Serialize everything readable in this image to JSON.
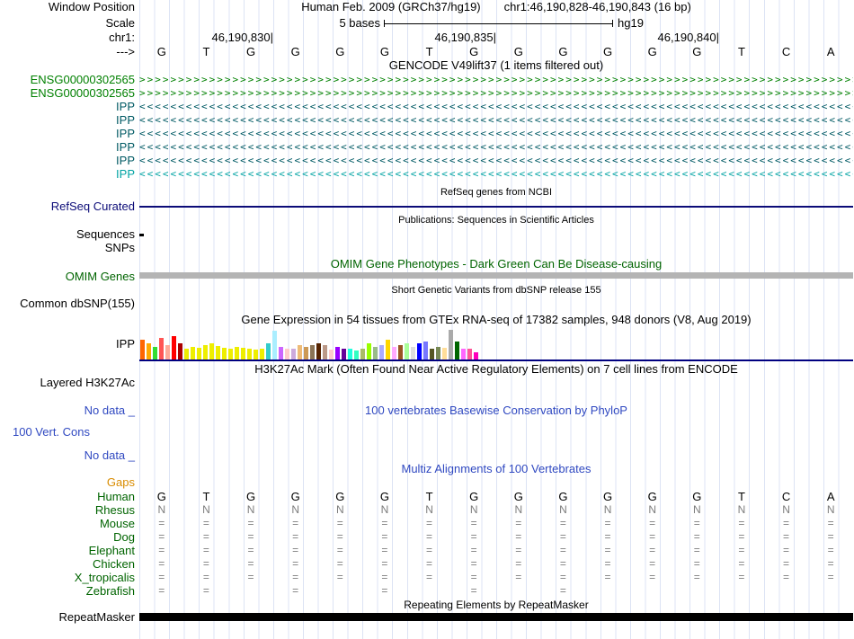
{
  "meta": {
    "assembly_title": "Human Feb. 2009 (GRCh37/hg19)",
    "position_title": "chr1:46,190,828-46,190,843 (16 bp)"
  },
  "labels": {
    "window_position": "Window Position",
    "scale": "Scale",
    "chrom": "chr1:",
    "strand_arrow": "--->"
  },
  "scale_bar": {
    "left_text": "5 bases",
    "right_text": "hg19"
  },
  "ruler": {
    "positions": [
      "46,190,830",
      "46,190,835",
      "46,190,840"
    ],
    "tick": "|"
  },
  "sequence": {
    "bases": [
      "G",
      "T",
      "G",
      "G",
      "G",
      "G",
      "T",
      "G",
      "G",
      "G",
      "G",
      "G",
      "G",
      "T",
      "C",
      "A"
    ]
  },
  "tracks": {
    "gencode": {
      "title": "GENCODE V49lift37 (1 items filtered out)",
      "rows": [
        {
          "label": "ENSG00000302565",
          "arrow": ">",
          "color": "#008000"
        },
        {
          "label": "ENSG00000302565",
          "arrow": ">",
          "color": "#008000"
        },
        {
          "label": "IPP",
          "arrow": "<",
          "color": "#005a64"
        },
        {
          "label": "IPP",
          "arrow": "<",
          "color": "#005a64"
        },
        {
          "label": "IPP",
          "arrow": "<",
          "color": "#005a64"
        },
        {
          "label": "IPP",
          "arrow": "<",
          "color": "#005a64"
        },
        {
          "label": "IPP",
          "arrow": "<",
          "color": "#005a64"
        },
        {
          "label": "IPP",
          "arrow": "<",
          "color": "#00a3a3"
        }
      ]
    },
    "refseq": {
      "title": "RefSeq genes from NCBI",
      "label": "RefSeq Curated",
      "line_color": "#0c0c78"
    },
    "publications": {
      "title": "Publications: Sequences in Scientific Articles",
      "sequences_label": "Sequences",
      "snps_label": "SNPs"
    },
    "omim": {
      "title": "OMIM Gene Phenotypes - Dark Green Can Be Disease-causing",
      "label": "OMIM Genes",
      "bar_color": "#b4b4b4"
    },
    "dbsnp": {
      "title": "Short Genetic Variants from dbSNP release 155",
      "label": "Common dbSNP(155)"
    },
    "gtex": {
      "title": "Gene Expression in 54 tissues from GTEx RNA-seq of 17382 samples, 948 donors (V8, Aug 2019)",
      "label": "IPP",
      "baseline_color": "#000080",
      "bars": {
        "colors": [
          "#FF6600",
          "#FFAA00",
          "#33DD33",
          "#FF5555",
          "#FFAA99",
          "#FF0000",
          "#AA0000",
          "#EEEE00",
          "#EEEE00",
          "#EEEE00",
          "#EEEE00",
          "#EEEE00",
          "#EEEE00",
          "#EEEE00",
          "#EEEE00",
          "#EEEE00",
          "#EEEE00",
          "#EEEE00",
          "#EEEE00",
          "#EEEE00",
          "#33CCCC",
          "#AAEEFF",
          "#CC66FF",
          "#FFCCCC",
          "#CCAADD",
          "#EEBB77",
          "#CC9955",
          "#8B7355",
          "#552200",
          "#BB9988",
          "#FFCCCC",
          "#9900FF",
          "#660099",
          "#22FFDD",
          "#33FFC2",
          "#AABB66",
          "#99FF00",
          "#99BB88",
          "#AAAAFF",
          "#FFD700",
          "#FFAAFF",
          "#995522",
          "#AAFF99",
          "#DDDDDD",
          "#0000FF",
          "#7777FF",
          "#555522",
          "#778855",
          "#FFDD99",
          "#AAAAAA",
          "#006600",
          "#FF66FF",
          "#FF5599",
          "#FF00BB"
        ],
        "heights": [
          22,
          18,
          14,
          24,
          16,
          26,
          18,
          12,
          14,
          13,
          16,
          18,
          15,
          13,
          12,
          14,
          13,
          12,
          11,
          12,
          18,
          32,
          14,
          12,
          12,
          16,
          14,
          16,
          18,
          16,
          11,
          14,
          12,
          12,
          10,
          12,
          18,
          14,
          16,
          22,
          14,
          16,
          18,
          14,
          18,
          20,
          12,
          14,
          13,
          33,
          20,
          12,
          12,
          8
        ]
      }
    },
    "h3k27ac": {
      "title": "H3K27Ac Mark (Often Found Near Active Regulatory Elements) on 7 cell lines from ENCODE",
      "label": "Layered H3K27Ac"
    },
    "phylop": {
      "title": "100 vertebrates Basewise Conservation by PhyloP",
      "label": "100 Vert. Cons",
      "no_data_label": "No data _"
    },
    "multiz": {
      "title": "Multiz Alignments of 100 Vertebrates",
      "gaps_label": "Gaps",
      "species": [
        {
          "name": "Human",
          "cell_color": "#000000",
          "cell_size": 13,
          "cells": [
            "G",
            "T",
            "G",
            "G",
            "G",
            "G",
            "T",
            "G",
            "G",
            "G",
            "G",
            "G",
            "G",
            "T",
            "C",
            "A"
          ]
        },
        {
          "name": "Rhesus",
          "cell_color": "#7d7d7d",
          "cell_size": 12,
          "cells": [
            "N",
            "N",
            "N",
            "N",
            "N",
            "N",
            "N",
            "N",
            "N",
            "N",
            "N",
            "N",
            "N",
            "N",
            "N",
            "N"
          ]
        },
        {
          "name": "Mouse",
          "cell_color": "#7d7d7d",
          "cell_size": 12,
          "cells": [
            "=",
            "=",
            "=",
            "=",
            "=",
            "=",
            "=",
            "=",
            "=",
            "=",
            "=",
            "=",
            "=",
            "=",
            "=",
            "="
          ]
        },
        {
          "name": "Dog",
          "cell_color": "#7d7d7d",
          "cell_size": 12,
          "cells": [
            "=",
            "=",
            "=",
            "=",
            "=",
            "=",
            "=",
            "=",
            "=",
            "=",
            "=",
            "=",
            "=",
            "=",
            "=",
            "="
          ]
        },
        {
          "name": "Elephant",
          "cell_color": "#7d7d7d",
          "cell_size": 12,
          "cells": [
            "=",
            "=",
            "=",
            "=",
            "=",
            "=",
            "=",
            "=",
            "=",
            "=",
            "=",
            "=",
            "=",
            "=",
            "=",
            "="
          ]
        },
        {
          "name": "Chicken",
          "cell_color": "#7d7d7d",
          "cell_size": 12,
          "cells": [
            "=",
            "=",
            "=",
            "=",
            "=",
            "=",
            "=",
            "=",
            "=",
            "=",
            "=",
            "=",
            "=",
            "=",
            "=",
            "="
          ]
        },
        {
          "name": "X_tropicalis",
          "cell_color": "#7d7d7d",
          "cell_size": 12,
          "cells": [
            "=",
            "=",
            "=",
            "=",
            "=",
            "=",
            "=",
            "=",
            "=",
            "=",
            "=",
            "=",
            "=",
            "=",
            "=",
            "="
          ]
        },
        {
          "name": "Zebrafish",
          "cell_color": "#7d7d7d",
          "cell_size": 12,
          "cells": [
            "=",
            "=",
            "",
            "=",
            "",
            "=",
            "",
            "=",
            "",
            "=",
            "",
            "",
            "",
            "",
            "",
            ""
          ]
        }
      ]
    },
    "repeatmasker": {
      "title": "Repeating Elements by RepeatMasker",
      "label": "RepeatMasker",
      "bar_color": "#000000"
    }
  },
  "colors": {
    "blue_text": "#3049c1",
    "green_text": "#006400",
    "orange_text": "#d98c00",
    "refseq_blue": "#0c0c78",
    "species_label": "#006400",
    "gridline": "#dce3f4",
    "gray_cell": "#7d7d7d"
  }
}
